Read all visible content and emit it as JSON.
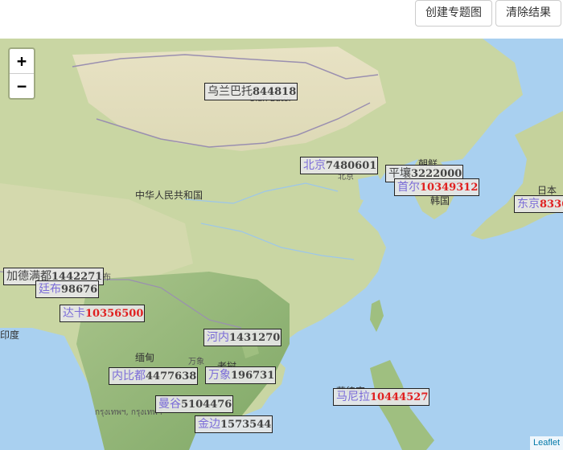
{
  "toolbar": {
    "create_label": "创建专题图",
    "clear_label": "清除结果"
  },
  "zoom": {
    "in_label": "+",
    "out_label": "−"
  },
  "map_text": {
    "country_china": "中华人民共和国",
    "ulaanbaatar_local": "Ulan Bator",
    "beijing_local": "北京",
    "korea_north": "朝鲜",
    "korea_south": "韩国",
    "japan": "日本",
    "myanmar": "缅甸",
    "vientiane_local": "万象",
    "laos": "老挝",
    "bangkok_local": "กรุงเทพฯ, กรุงเทพฯ",
    "philippines": "菲律宾",
    "nepal": "尼泊布",
    "india": "印度"
  },
  "cities": [
    {
      "name": "乌兰巴托",
      "value": "844818",
      "highlight": false,
      "name_style": "dark"
    },
    {
      "name": "北京",
      "value": "7480601",
      "highlight": false,
      "name_style": "blue"
    },
    {
      "name": "平壤",
      "value": "3222000",
      "highlight": false,
      "name_style": "dark"
    },
    {
      "name": "首尔",
      "value": "10349312",
      "highlight": true,
      "name_style": "blue"
    },
    {
      "name": "东京",
      "value": "8336",
      "highlight": true,
      "name_style": "blue"
    },
    {
      "name": "加德满都",
      "value": "1442271",
      "highlight": false,
      "name_style": "dark"
    },
    {
      "name": "廷布",
      "value": "98676",
      "highlight": false,
      "name_style": "blue"
    },
    {
      "name": "达卡",
      "value": "10356500",
      "highlight": true,
      "name_style": "blue"
    },
    {
      "name": "河内",
      "value": "1431270",
      "highlight": false,
      "name_style": "blue"
    },
    {
      "name": "内比都",
      "value": "4477638",
      "highlight": false,
      "name_style": "blue"
    },
    {
      "name": "万象",
      "value": "196731",
      "highlight": false,
      "name_style": "blue"
    },
    {
      "name": "曼谷",
      "value": "5104476",
      "highlight": false,
      "name_style": "blue"
    },
    {
      "name": "金边",
      "value": "1573544",
      "highlight": false,
      "name_style": "blue"
    },
    {
      "name": "马尼拉",
      "value": "10444527",
      "highlight": true,
      "name_style": "blue"
    }
  ],
  "attribution": "Leaflet",
  "colors": {
    "water": "#a9d0f0",
    "land": "#c9d6a3",
    "highlight_value": "#e02020",
    "city_name": "#7b6cd8"
  }
}
